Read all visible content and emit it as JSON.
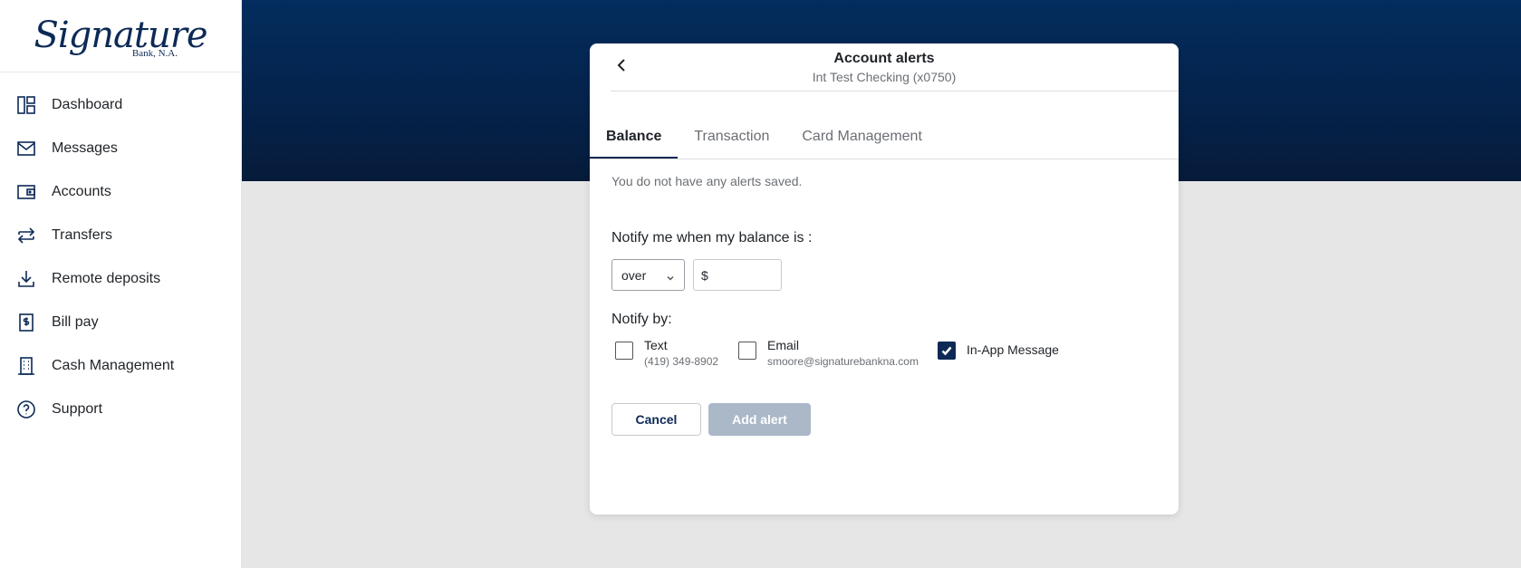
{
  "brand": {
    "logo_script": "Signature",
    "logo_sub": "Bank, N.A."
  },
  "sidebar": {
    "items": [
      {
        "label": "Dashboard",
        "icon": "dashboard-icon"
      },
      {
        "label": "Messages",
        "icon": "mail-icon"
      },
      {
        "label": "Accounts",
        "icon": "wallet-icon"
      },
      {
        "label": "Transfers",
        "icon": "transfer-icon"
      },
      {
        "label": "Remote deposits",
        "icon": "download-icon"
      },
      {
        "label": "Bill pay",
        "icon": "bill-icon"
      },
      {
        "label": "Cash Management",
        "icon": "building-icon"
      },
      {
        "label": "Support",
        "icon": "help-icon"
      }
    ]
  },
  "modal": {
    "title": "Account alerts",
    "subtitle": "Int Test Checking (x0750)",
    "tabs": [
      {
        "label": "Balance",
        "active": true
      },
      {
        "label": "Transaction",
        "active": false
      },
      {
        "label": "Card Management",
        "active": false
      }
    ],
    "empty_message": "You do not have any alerts saved.",
    "notify_label": "Notify me when my balance is :",
    "condition": {
      "selected": "over"
    },
    "amount": {
      "prefix": "$",
      "value": ""
    },
    "notify_by_label": "Notify by:",
    "channels": {
      "text": {
        "label": "Text",
        "detail": "(419) 349-8902",
        "checked": false
      },
      "email": {
        "label": "Email",
        "detail": "smoore@signaturebankna.com",
        "checked": false
      },
      "inapp": {
        "label": "In-App Message",
        "checked": true
      }
    },
    "buttons": {
      "cancel": "Cancel",
      "add": "Add alert"
    }
  },
  "colors": {
    "navy": "#0d2a56",
    "banner": "#032d5e",
    "disabled": "#aab8c8"
  }
}
